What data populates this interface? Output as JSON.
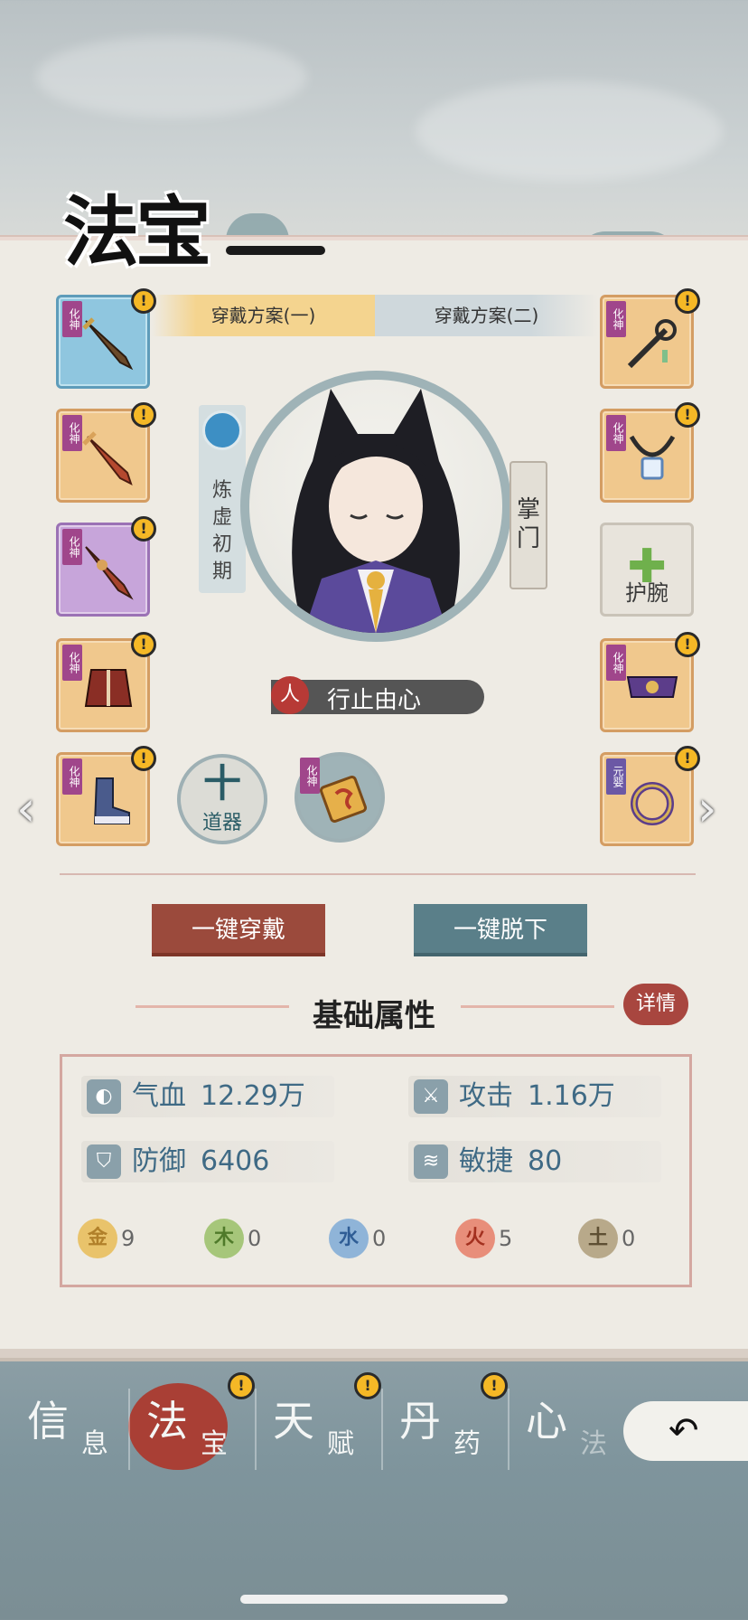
{
  "page": {
    "title": "法宝"
  },
  "tabs": [
    {
      "label": "穿戴方案(一)",
      "active": true
    },
    {
      "label": "穿戴方案(二)",
      "active": false
    }
  ],
  "character": {
    "realm": "炼虚初期",
    "sect_role": "掌门",
    "motto_prefix": "人",
    "motto": "行止由心"
  },
  "left_slots": [
    {
      "badge": "化神",
      "rarity": "blue",
      "alert": "!"
    },
    {
      "badge": "化神",
      "rarity": "orange",
      "alert": "!"
    },
    {
      "badge": "化神",
      "rarity": "purple",
      "alert": "!"
    },
    {
      "badge": "化神",
      "rarity": "orange",
      "alert": "!"
    },
    {
      "badge": "化神",
      "rarity": "orange",
      "alert": "!"
    }
  ],
  "right_slots": [
    {
      "badge": "化神",
      "rarity": "orange",
      "alert": "!"
    },
    {
      "badge": "化神",
      "rarity": "orange",
      "alert": "!"
    },
    {
      "label": "护腕",
      "rarity": "empty"
    },
    {
      "badge": "化神",
      "rarity": "orange",
      "alert": "!"
    },
    {
      "badge": "元婴",
      "rarity": "orange",
      "alert": "!"
    }
  ],
  "daoqi": {
    "plus": "十",
    "label": "道器"
  },
  "talisman": {
    "badge": "化神"
  },
  "actions": {
    "equip_all": "一键穿戴",
    "unequip_all": "一键脱下"
  },
  "attributes": {
    "title": "基础属性",
    "detail": "详情",
    "hp": {
      "label": "气血",
      "value": "12.29万"
    },
    "attack": {
      "label": "攻击",
      "value": "1.16万"
    },
    "defense": {
      "label": "防御",
      "value": "6406"
    },
    "agility": {
      "label": "敏捷",
      "value": "80"
    },
    "elements": [
      {
        "name": "金",
        "value": "9",
        "color": "#e9c36b"
      },
      {
        "name": "木",
        "value": "0",
        "color": "#a6c67a"
      },
      {
        "name": "水",
        "value": "0",
        "color": "#8fb4d8"
      },
      {
        "name": "火",
        "value": "5",
        "color": "#e88e7a"
      },
      {
        "name": "土",
        "value": "0",
        "color": "#b8a98a"
      }
    ]
  },
  "bottom_nav": [
    {
      "big": "信",
      "small": "息",
      "alert": ""
    },
    {
      "big": "法",
      "small": "宝",
      "alert": "!"
    },
    {
      "big": "天",
      "small": "赋",
      "alert": "!"
    },
    {
      "big": "丹",
      "small": "药",
      "alert": "!"
    },
    {
      "big": "心",
      "small": "法",
      "alert": ""
    }
  ],
  "back_icon": "back-arrow-icon",
  "alert_symbol": "!"
}
